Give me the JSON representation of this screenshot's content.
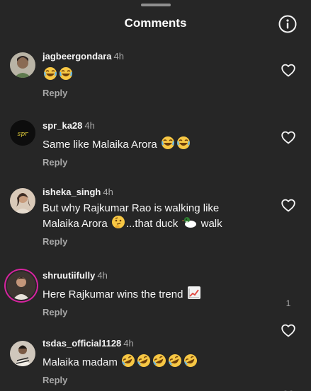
{
  "header": {
    "title": "Comments",
    "info_icon": "info-icon"
  },
  "comments": [
    {
      "username": "jagbeergondara",
      "time": "4h",
      "text_before": "",
      "text_after": "",
      "reply_label": "Reply",
      "avatar": "avatar-photo",
      "like_count": ""
    },
    {
      "username": "spr_ka28",
      "time": "4h",
      "text_before": "Same like Malaika Arora",
      "reply_label": "Reply",
      "avatar": "avatar-logo",
      "like_count": ""
    },
    {
      "username": "isheka_singh",
      "time": "4h",
      "line1": "But why Rajkumar Rao is walking like",
      "line2_a": "Malaika Arora",
      "line2_b": "...that duck",
      "line2_c": "walk",
      "reply_label": "Reply",
      "avatar": "avatar-photo",
      "like_count": ""
    },
    {
      "username": "shruutiifully",
      "time": "4h",
      "text_before": "Here Rajkumar wins the trend",
      "reply_label": "Reply",
      "avatar": "avatar-photo",
      "like_count": "1"
    },
    {
      "username": "tsdas_official1128",
      "time": "4h",
      "text_before": "Malaika madam",
      "reply_label": "Reply",
      "avatar": "avatar-photo",
      "like_count": ""
    }
  ],
  "colors": {
    "background": "#262626",
    "primary_text": "#f5f5f5",
    "secondary_text": "#a8a8a8",
    "story_ring": "#d6249f"
  }
}
